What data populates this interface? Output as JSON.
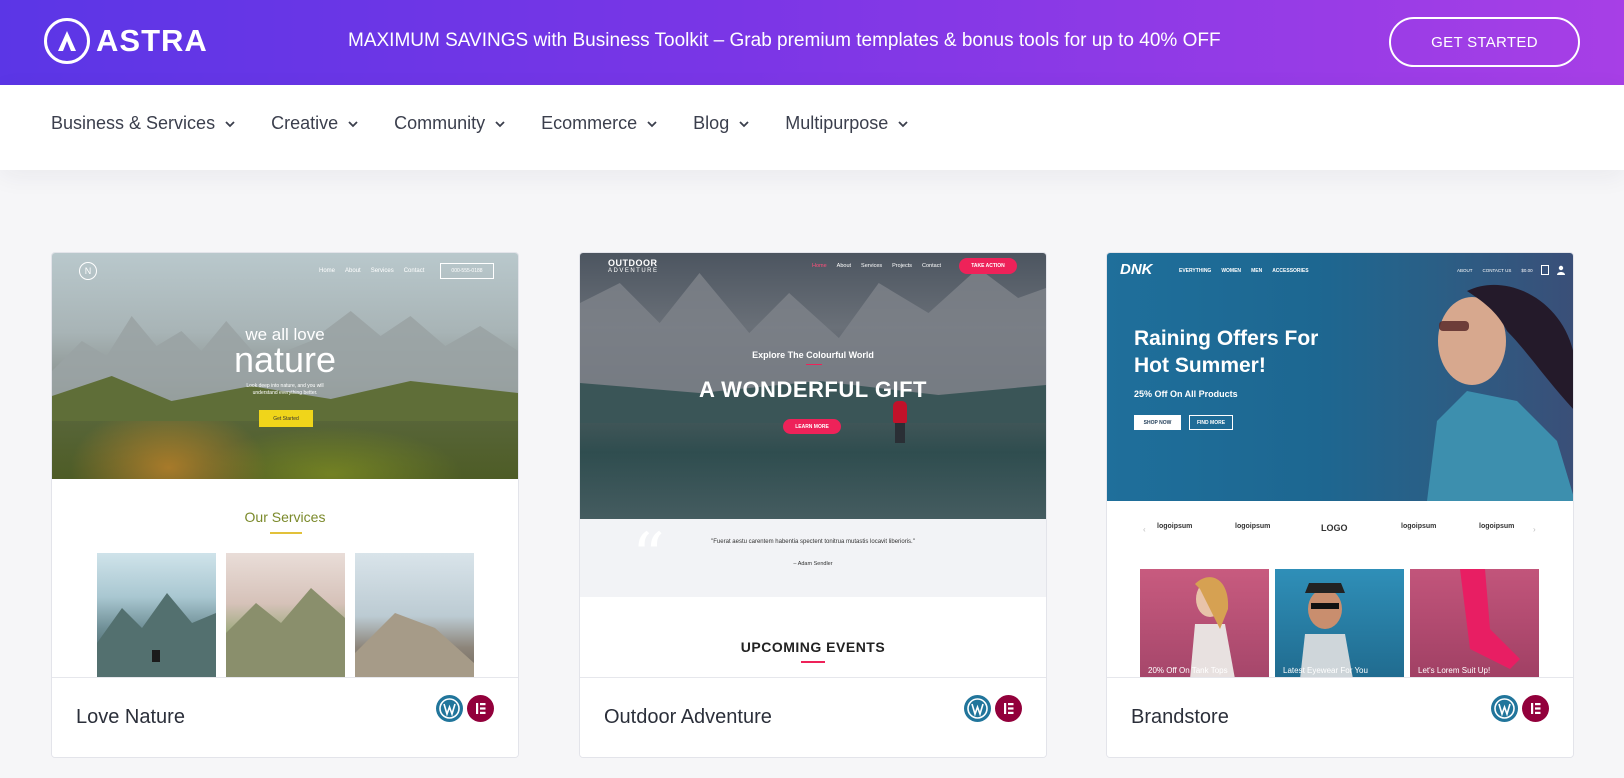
{
  "banner": {
    "logo_text": "ASTRA",
    "promo_text": "MAXIMUM SAVINGS with Business Toolkit – Grab premium templates & bonus tools for up to 40% OFF",
    "cta_label": "GET STARTED"
  },
  "nav": {
    "items": [
      {
        "label": "Business & Services"
      },
      {
        "label": "Creative"
      },
      {
        "label": "Community"
      },
      {
        "label": "Ecommerce"
      },
      {
        "label": "Blog"
      },
      {
        "label": "Multipurpose"
      }
    ]
  },
  "cards": [
    {
      "title": "Love Nature",
      "preview": {
        "logo_letter": "N",
        "nav": [
          "Home",
          "About",
          "Services",
          "Contact"
        ],
        "phone": "000-555-0188",
        "small_heading": "we all love",
        "big_heading": "nature",
        "tagline_1": "Look deep into nature, and you will",
        "tagline_2": "understand everything better.",
        "button": "Get Started",
        "section_title": "Our Services"
      }
    },
    {
      "title": "Outdoor Adventure",
      "preview": {
        "brand_1": "OUTDOOR",
        "brand_2": "ADVENTURE",
        "nav": [
          "Home",
          "About",
          "Services",
          "Projects",
          "Contact"
        ],
        "nav_button": "TAKE ACTION",
        "kicker": "Explore The Colourful World",
        "headline": "A WONDERFUL GIFT",
        "button": "LEARN MORE",
        "quote": "\"Fuerat aestu carentem habentia spectent tonitrua mutastis locavit liberioris.\"",
        "quote_author": "– Adam Sendler",
        "section_title": "UPCOMING EVENTS"
      }
    },
    {
      "title": "Brandstore",
      "preview": {
        "brand": "DNK",
        "nav": [
          "EVERYTHING",
          "WOMEN",
          "MEN",
          "ACCESSORIES"
        ],
        "nav_right": [
          "ABOUT",
          "CONTACT US",
          "$0.00"
        ],
        "headline_1": "Raining Offers For",
        "headline_2": "Hot Summer!",
        "offer": "25% Off On All Products",
        "btn_primary": "SHOP NOW",
        "btn_secondary": "FIND MORE",
        "logos": [
          "logoipsum",
          "logoipsum",
          "LOGO",
          "logoipsum",
          "logoipsum"
        ],
        "products": [
          "20% Off On Tank Tops",
          "Latest Eyewear For You",
          "Let's Lorem Suit Up!"
        ]
      }
    }
  ]
}
